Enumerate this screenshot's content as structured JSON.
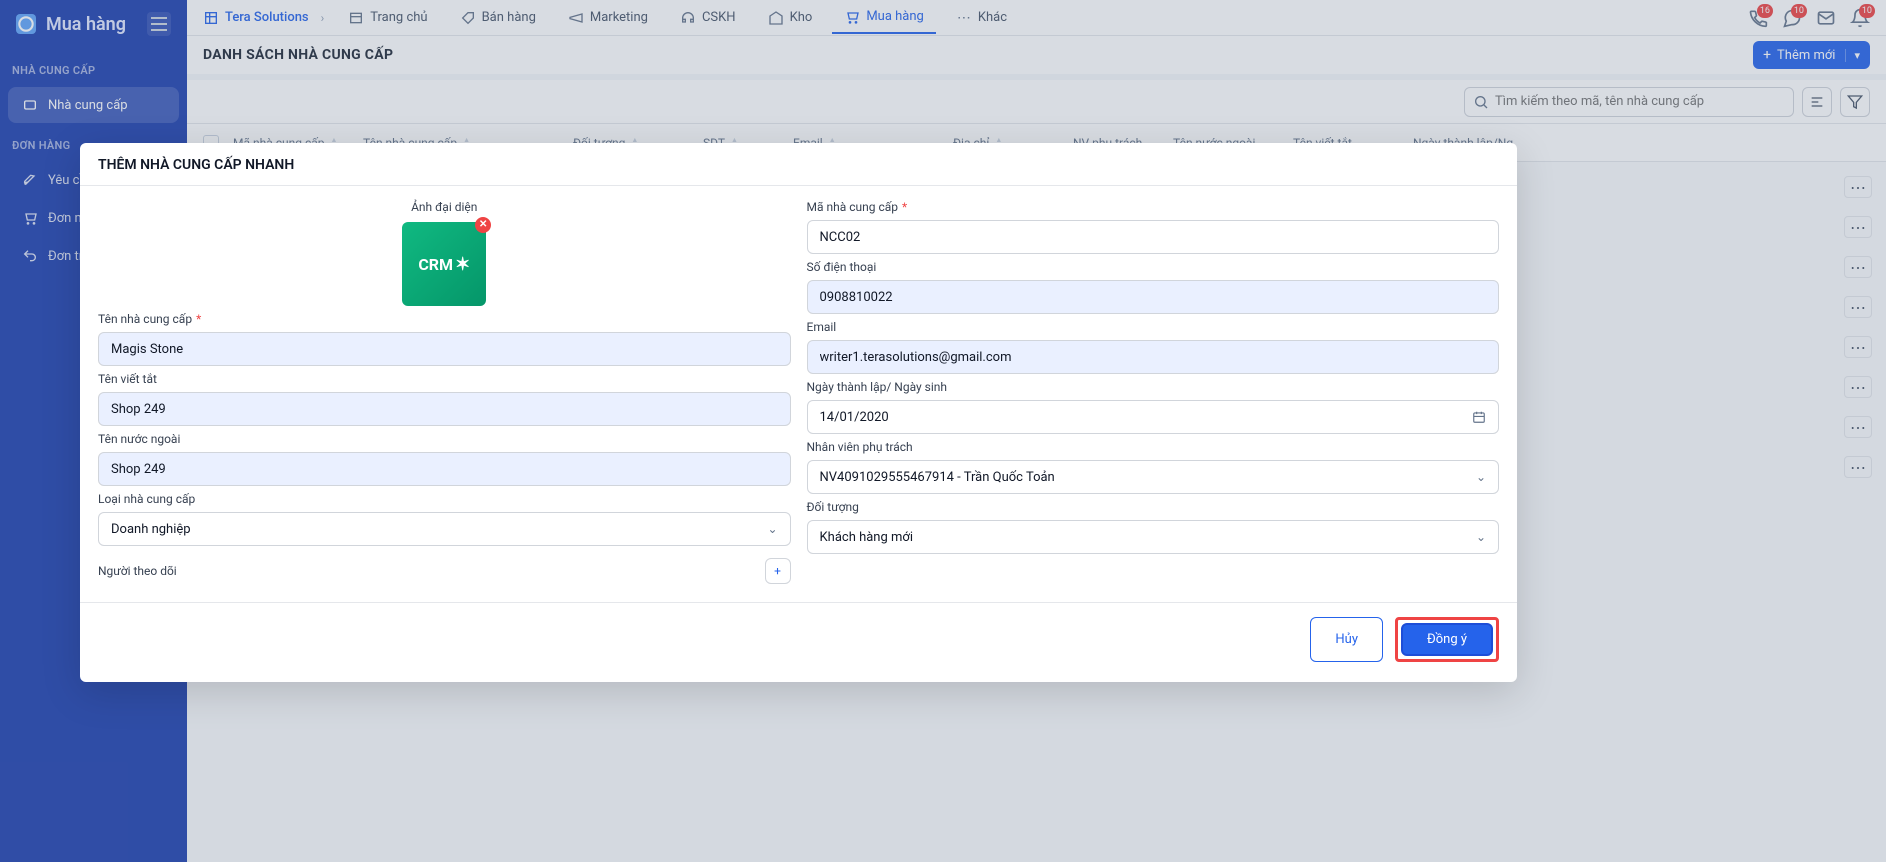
{
  "sidebar": {
    "title": "Mua hàng",
    "sections": {
      "suppliers": "NHÀ CUNG CẤP",
      "orders": "ĐƠN HÀNG"
    },
    "items": {
      "supplier": "Nhà cung cấp",
      "request": "Yêu cầu",
      "purchase_order": "Đơn mu",
      "return_order": "Đơn trả l"
    }
  },
  "topnav": {
    "brand": "Tera Solutions",
    "items": {
      "home": "Trang chủ",
      "sales": "Bán hàng",
      "marketing": "Marketing",
      "cskh": "CSKH",
      "inventory": "Kho",
      "purchase": "Mua hàng",
      "other": "Khác"
    },
    "badges": {
      "phone": "16",
      "chat": "10",
      "bell": "10"
    }
  },
  "page": {
    "title": "DANH SÁCH NHÀ CUNG CẤP",
    "add_button": "Thêm mới",
    "search_placeholder": "Tìm kiếm theo mã, tên nhà cung cấp"
  },
  "table": {
    "columns": {
      "code": "Mã nhà cung cấp",
      "name": "Tên nhà cung cấp",
      "target": "Đối tượng",
      "phone": "SDT",
      "email": "Email",
      "address": "Địa chỉ",
      "staff": "NV phụ trách",
      "foreign_name": "Tên nước ngoài",
      "short_name": "Tên viết tắt",
      "founded": "Ngày thành lập/Ng"
    }
  },
  "modal": {
    "title": "THÊM NHÀ CUNG CẤP NHANH",
    "avatar_label": "Ảnh đại diện",
    "avatar_text": "CRM",
    "fields": {
      "supplier_name": {
        "label": "Tên nhà cung cấp",
        "value": "Magis Stone"
      },
      "short_name": {
        "label": "Tên viết tắt",
        "value": "Shop 249"
      },
      "foreign_name": {
        "label": "Tên nước ngoài",
        "value": "Shop 249"
      },
      "supplier_type": {
        "label": "Loại nhà cung cấp",
        "value": "Doanh nghiệp"
      },
      "followers": {
        "label": "Người theo dõi"
      },
      "supplier_code": {
        "label": "Mã nhà cung cấp",
        "value": "NCC02"
      },
      "phone": {
        "label": "Số điện thoại",
        "value": "0908810022"
      },
      "email": {
        "label": "Email",
        "value": "writer1.terasolutions@gmail.com"
      },
      "founded_date": {
        "label": "Ngày thành lập/ Ngày sinh",
        "value": "14/01/2020"
      },
      "staff": {
        "label": "Nhân viên phụ trách",
        "value": "NV4091029555467914 - Trần Quốc Toản"
      },
      "target": {
        "label": "Đối tượng",
        "value": "Khách hàng mới"
      }
    },
    "buttons": {
      "cancel": "Hủy",
      "ok": "Đồng ý"
    }
  }
}
